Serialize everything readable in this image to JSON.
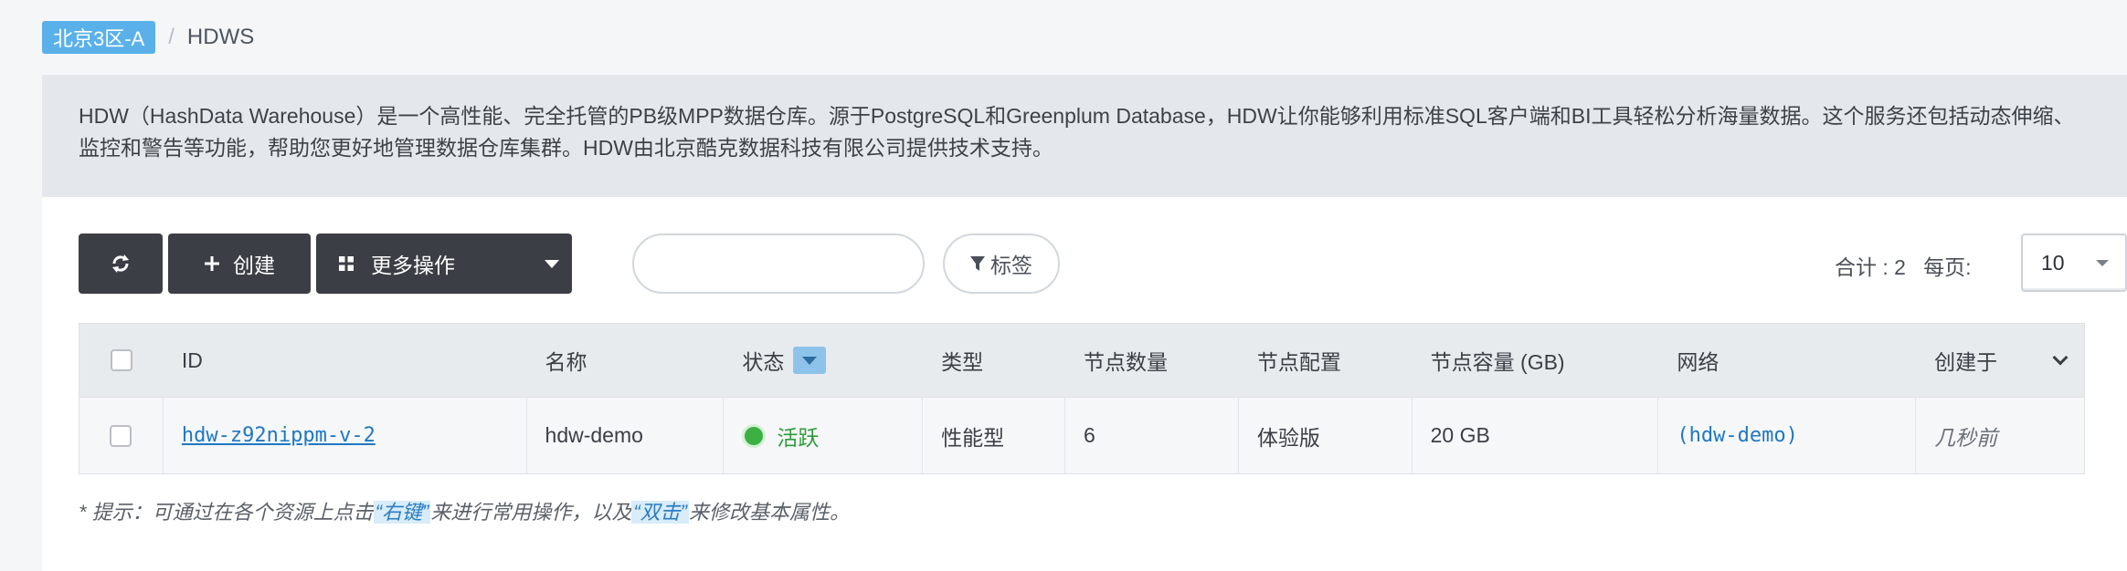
{
  "breadcrumb": {
    "zone": "北京3区-A",
    "separator": "/",
    "current": "HDWS"
  },
  "description": "HDW（HashData Warehouse）是一个高性能、完全托管的PB级MPP数据仓库。源于PostgreSQL和Greenplum Database，HDW让你能够利用标准SQL客户端和BI工具轻松分析海量数据。这个服务还包括动态伸缩、监控和警告等功能，帮助您更好地管理数据仓库集群。HDW由北京酷克数据科技有限公司提供技术支持。",
  "toolbar": {
    "refresh_icon": "refresh-icon",
    "create_label": "创建",
    "more_label": "更多操作",
    "search_placeholder": "",
    "tag_label": "标签"
  },
  "pagination": {
    "total": "合计 : 2",
    "per_page_label": "每页:",
    "per_page_value": "10"
  },
  "table": {
    "columns": [
      "ID",
      "名称",
      "状态",
      "类型",
      "节点数量",
      "节点配置",
      "节点容量 (GB)",
      "网络",
      "创建于"
    ],
    "rows": [
      {
        "id": "hdw-z92nippm-v-2",
        "name": "hdw-demo",
        "status": "活跃",
        "type": "性能型",
        "nodes": "6",
        "config": "体验版",
        "capacity": "20 GB",
        "network": "(hdw-demo)",
        "created": "几秒前"
      }
    ]
  },
  "hint": {
    "prefix": "* 提示：可通过在各个资源上点击",
    "right_click": "“右键”",
    "middle": "来进行常用操作，以及",
    "double_click": "“双击”",
    "suffix": "来修改基本属性。"
  },
  "colors": {
    "zone_badge": "#5ab1ea",
    "dark_button": "#3b3e44",
    "link": "#1f78c2",
    "status_active": "#3cb043"
  }
}
